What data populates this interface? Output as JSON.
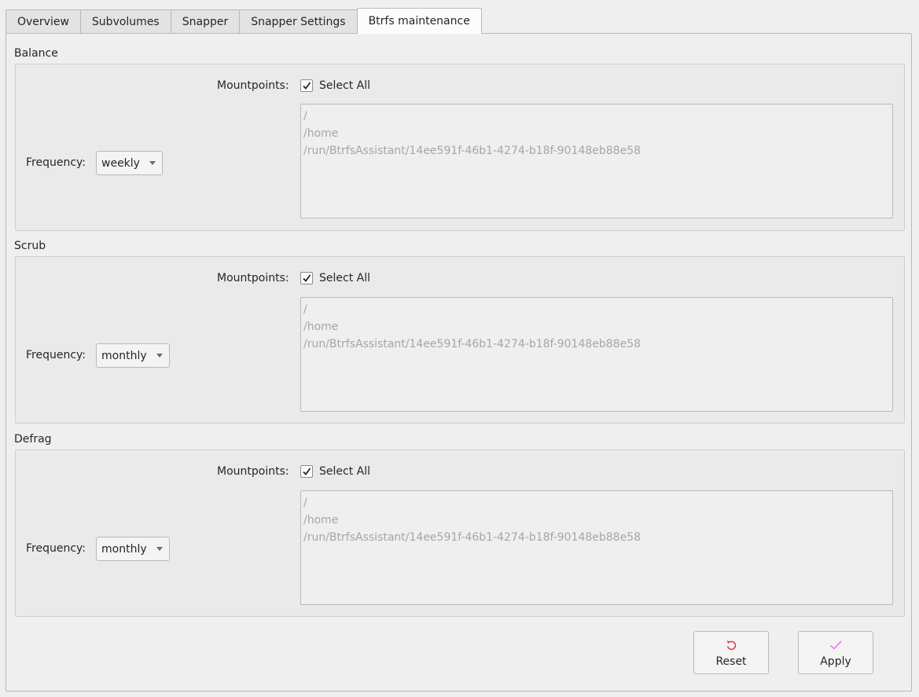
{
  "tabs": [
    {
      "label": "Overview"
    },
    {
      "label": "Subvolumes"
    },
    {
      "label": "Snapper"
    },
    {
      "label": "Snapper Settings"
    },
    {
      "label": "Btrfs maintenance",
      "active": true
    }
  ],
  "sections": {
    "balance": {
      "title": "Balance",
      "mountpoints_label": "Mountpoints:",
      "select_all_label": "Select All",
      "select_all_checked": true,
      "mountpoints": [
        "/",
        "/home",
        "/run/BtrfsAssistant/14ee591f-46b1-4274-b18f-90148eb88e58"
      ],
      "frequency_label": "Frequency:",
      "frequency_value": "weekly"
    },
    "scrub": {
      "title": "Scrub",
      "mountpoints_label": "Mountpoints:",
      "select_all_label": "Select All",
      "select_all_checked": true,
      "mountpoints": [
        "/",
        "/home",
        "/run/BtrfsAssistant/14ee591f-46b1-4274-b18f-90148eb88e58"
      ],
      "frequency_label": "Frequency:",
      "frequency_value": "monthly"
    },
    "defrag": {
      "title": "Defrag",
      "mountpoints_label": "Mountpoints:",
      "select_all_label": "Select All",
      "select_all_checked": true,
      "mountpoints": [
        "/",
        "/home",
        "/run/BtrfsAssistant/14ee591f-46b1-4274-b18f-90148eb88e58"
      ],
      "frequency_label": "Frequency:",
      "frequency_value": "monthly"
    }
  },
  "buttons": {
    "reset": {
      "label": "Reset",
      "icon": "undo-icon",
      "icon_color": "#da4453"
    },
    "apply": {
      "label": "Apply",
      "icon": "checkmark-icon",
      "icon_color": "#e36ef0"
    }
  }
}
